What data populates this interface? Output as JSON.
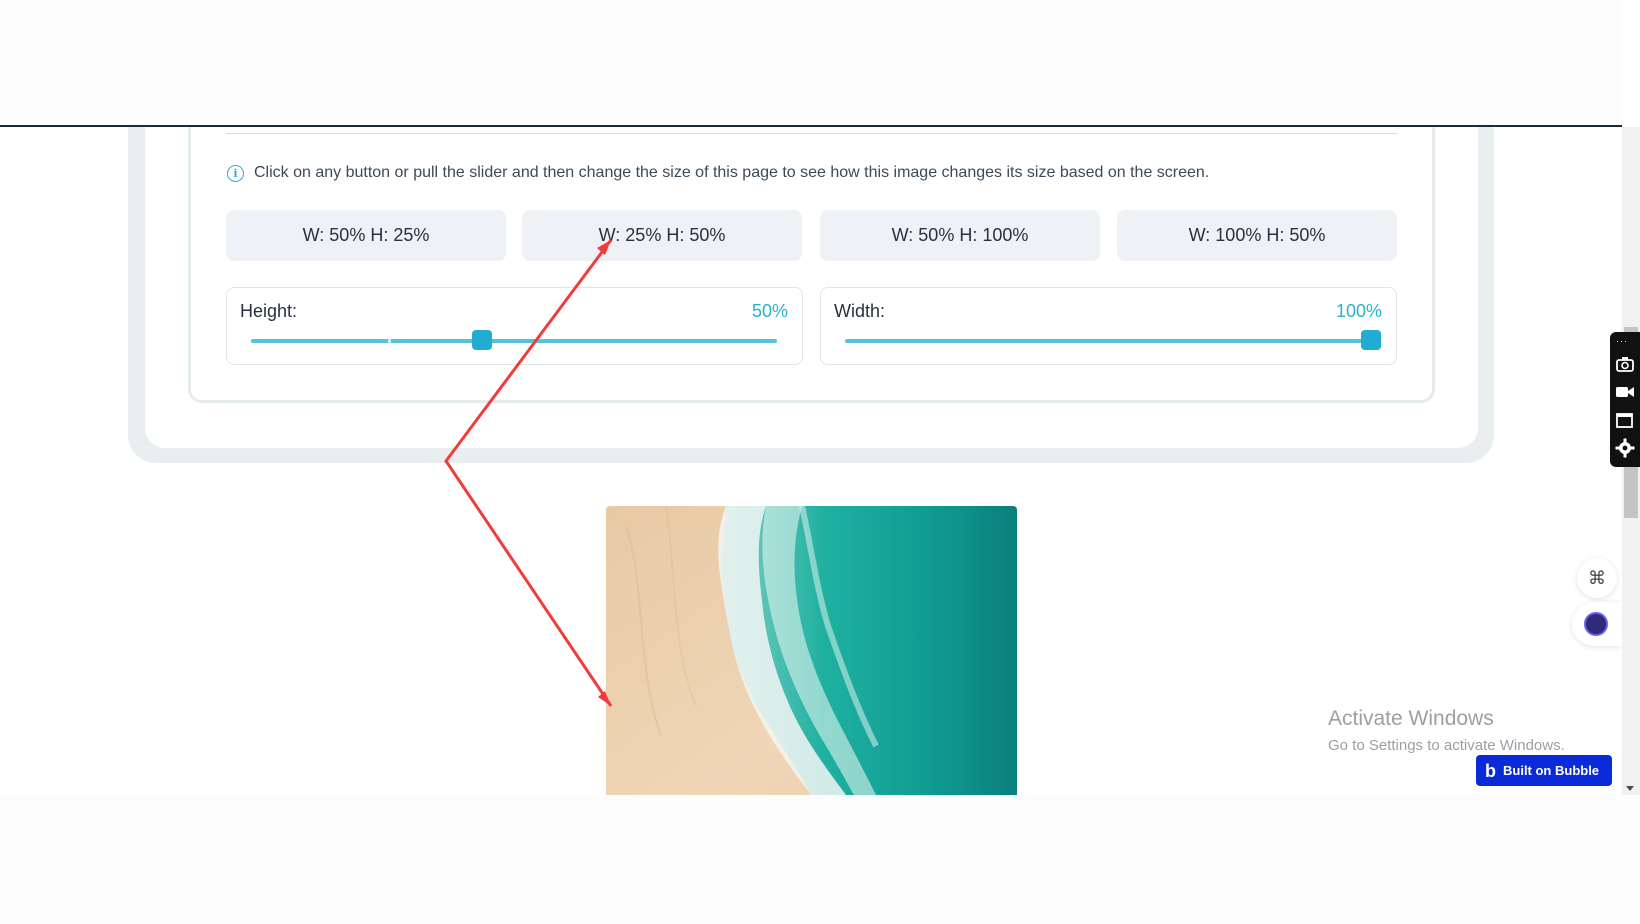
{
  "info": {
    "text": "Click on any button or pull the slider and then change the size of this page to see how this image changes its size based on the screen."
  },
  "presets": [
    {
      "label": "W: 50% H: 25%"
    },
    {
      "label": "W: 25% H: 50%"
    },
    {
      "label": "W: 50% H: 100%"
    },
    {
      "label": "W: 100% H: 50%"
    }
  ],
  "sliders": {
    "height": {
      "label": "Height:",
      "value_text": "50%",
      "value": 0.44
    },
    "width": {
      "label": "Width:",
      "value_text": "100%",
      "value": 1.0
    }
  },
  "windows_watermark": {
    "title": "Activate Windows",
    "subtitle": "Go to Settings to activate Windows."
  },
  "bubble_badge": {
    "label": "Built on Bubble"
  },
  "colors": {
    "accent": "#2ab0d3",
    "annotation_arrow": "#f23b3b",
    "bubble_blue": "#0b2bd8"
  },
  "icons": [
    "info-icon",
    "camera-icon",
    "video-icon",
    "window-icon",
    "gear-icon",
    "command-key-icon",
    "bot-icon",
    "bubble-logo-icon"
  ]
}
